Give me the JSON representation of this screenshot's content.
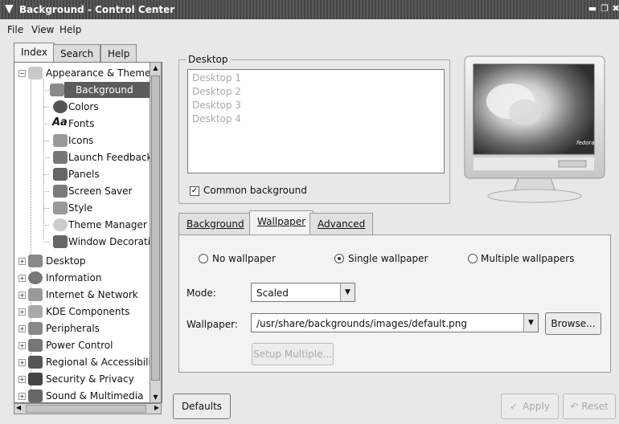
{
  "window": {
    "title": "Background - Control Center"
  },
  "menu": {
    "file": "File",
    "view": "View",
    "help": "Help"
  },
  "left_tabs": {
    "index": "Index",
    "search": "Search",
    "help": "Help"
  },
  "tree": {
    "appearance": "Appearance & Themes",
    "background": "Background",
    "colors": "Colors",
    "fonts": "Fonts",
    "icons": "Icons",
    "launch_feedback": "Launch Feedback",
    "panels": "Panels",
    "screen_saver": "Screen Saver",
    "style": "Style",
    "theme_manager": "Theme Manager",
    "window_decorations": "Window Decorations",
    "desktop": "Desktop",
    "information": "Information",
    "internet_network": "Internet & Network",
    "kde_components": "KDE Components",
    "peripherals": "Peripherals",
    "power_control": "Power Control",
    "regional": "Regional & Accessibility",
    "security": "Security & Privacy",
    "sound": "Sound & Multimedia"
  },
  "desktop_group": {
    "title": "Desktop",
    "items": [
      "Desktop 1",
      "Desktop 2",
      "Desktop 3",
      "Desktop 4"
    ],
    "common_background": "Common background",
    "common_background_checked": true
  },
  "tabs": {
    "background": "Background",
    "wallpaper": "Wallpaper",
    "advanced": "Advanced"
  },
  "wallpaper": {
    "no_wallpaper": "No wallpaper",
    "single_wallpaper": "Single wallpaper",
    "multiple_wallpapers": "Multiple wallpapers",
    "mode_label": "Mode:",
    "mode_value": "Scaled",
    "wallpaper_label": "Wallpaper:",
    "wallpaper_value": "/usr/share/backgrounds/images/default.png",
    "browse": "Browse...",
    "setup_multiple": "Setup Multiple..."
  },
  "buttons": {
    "defaults": "Defaults",
    "apply": "Apply",
    "reset": "Reset"
  },
  "monitor": {
    "brand": "fedora"
  }
}
